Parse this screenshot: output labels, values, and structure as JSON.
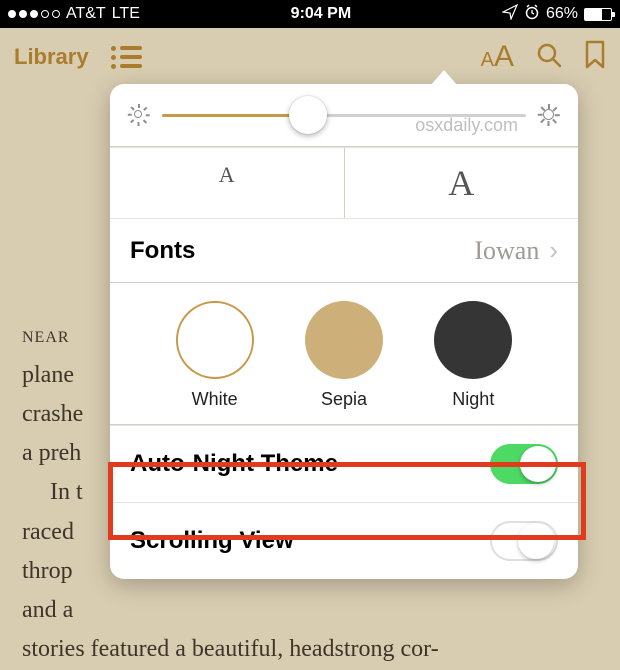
{
  "status": {
    "carrier": "AT&T",
    "network": "LTE",
    "time": "9:04 PM",
    "battery_pct": "66%"
  },
  "toolbar": {
    "library_label": "Library"
  },
  "book": {
    "chapter_prefix": "NEAR",
    "line1": "plane",
    "line2": "crashe",
    "line3": "a preh",
    "line4": "In t",
    "line5": "raced",
    "line6": "throp",
    "line7": "and a",
    "last": "stories featured a beautiful, headstrong cor-"
  },
  "popover": {
    "watermark": "osxdaily.com",
    "font_small": "A",
    "font_large": "A",
    "fonts_label": "Fonts",
    "fonts_value": "Iowan",
    "themes": {
      "white": "White",
      "sepia": "Sepia",
      "night": "Night"
    },
    "auto_night_label": "Auto-Night Theme",
    "auto_night_on": true,
    "scrolling_label": "Scrolling View",
    "scrolling_on": false
  }
}
